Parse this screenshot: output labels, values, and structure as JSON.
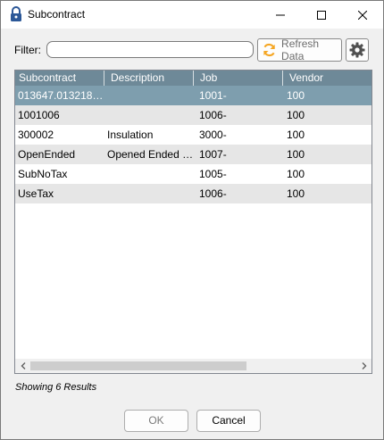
{
  "window": {
    "title": "Subcontract"
  },
  "filter": {
    "label": "Filter:",
    "value": "",
    "refresh_label": "Refresh Data"
  },
  "grid": {
    "columns": [
      "Subcontract",
      "Description",
      "Job",
      "Vendor"
    ],
    "rows": [
      {
        "subcontract": "013647.013218-F...",
        "description": "",
        "job": "1001-",
        "vendor": "100",
        "selected": true
      },
      {
        "subcontract": "1001006",
        "description": "",
        "job": "1006-",
        "vendor": "100",
        "selected": false
      },
      {
        "subcontract": "300002",
        "description": "Insulation",
        "job": "3000-",
        "vendor": "100",
        "selected": false
      },
      {
        "subcontract": "OpenEnded",
        "description": "Opened Ended s...",
        "job": "1007-",
        "vendor": "100",
        "selected": false
      },
      {
        "subcontract": "SubNoTax",
        "description": "",
        "job": "1005-",
        "vendor": "100",
        "selected": false
      },
      {
        "subcontract": "UseTax",
        "description": "",
        "job": "1006-",
        "vendor": "100",
        "selected": false
      }
    ]
  },
  "status": {
    "text": "Showing 6 Results"
  },
  "buttons": {
    "ok": "OK",
    "cancel": "Cancel"
  },
  "colors": {
    "header_bg": "#6e8998",
    "selected_row_bg": "#7e9eae",
    "alt_row_bg": "#e6e6e6",
    "refresh_icon": "#f5a623"
  }
}
